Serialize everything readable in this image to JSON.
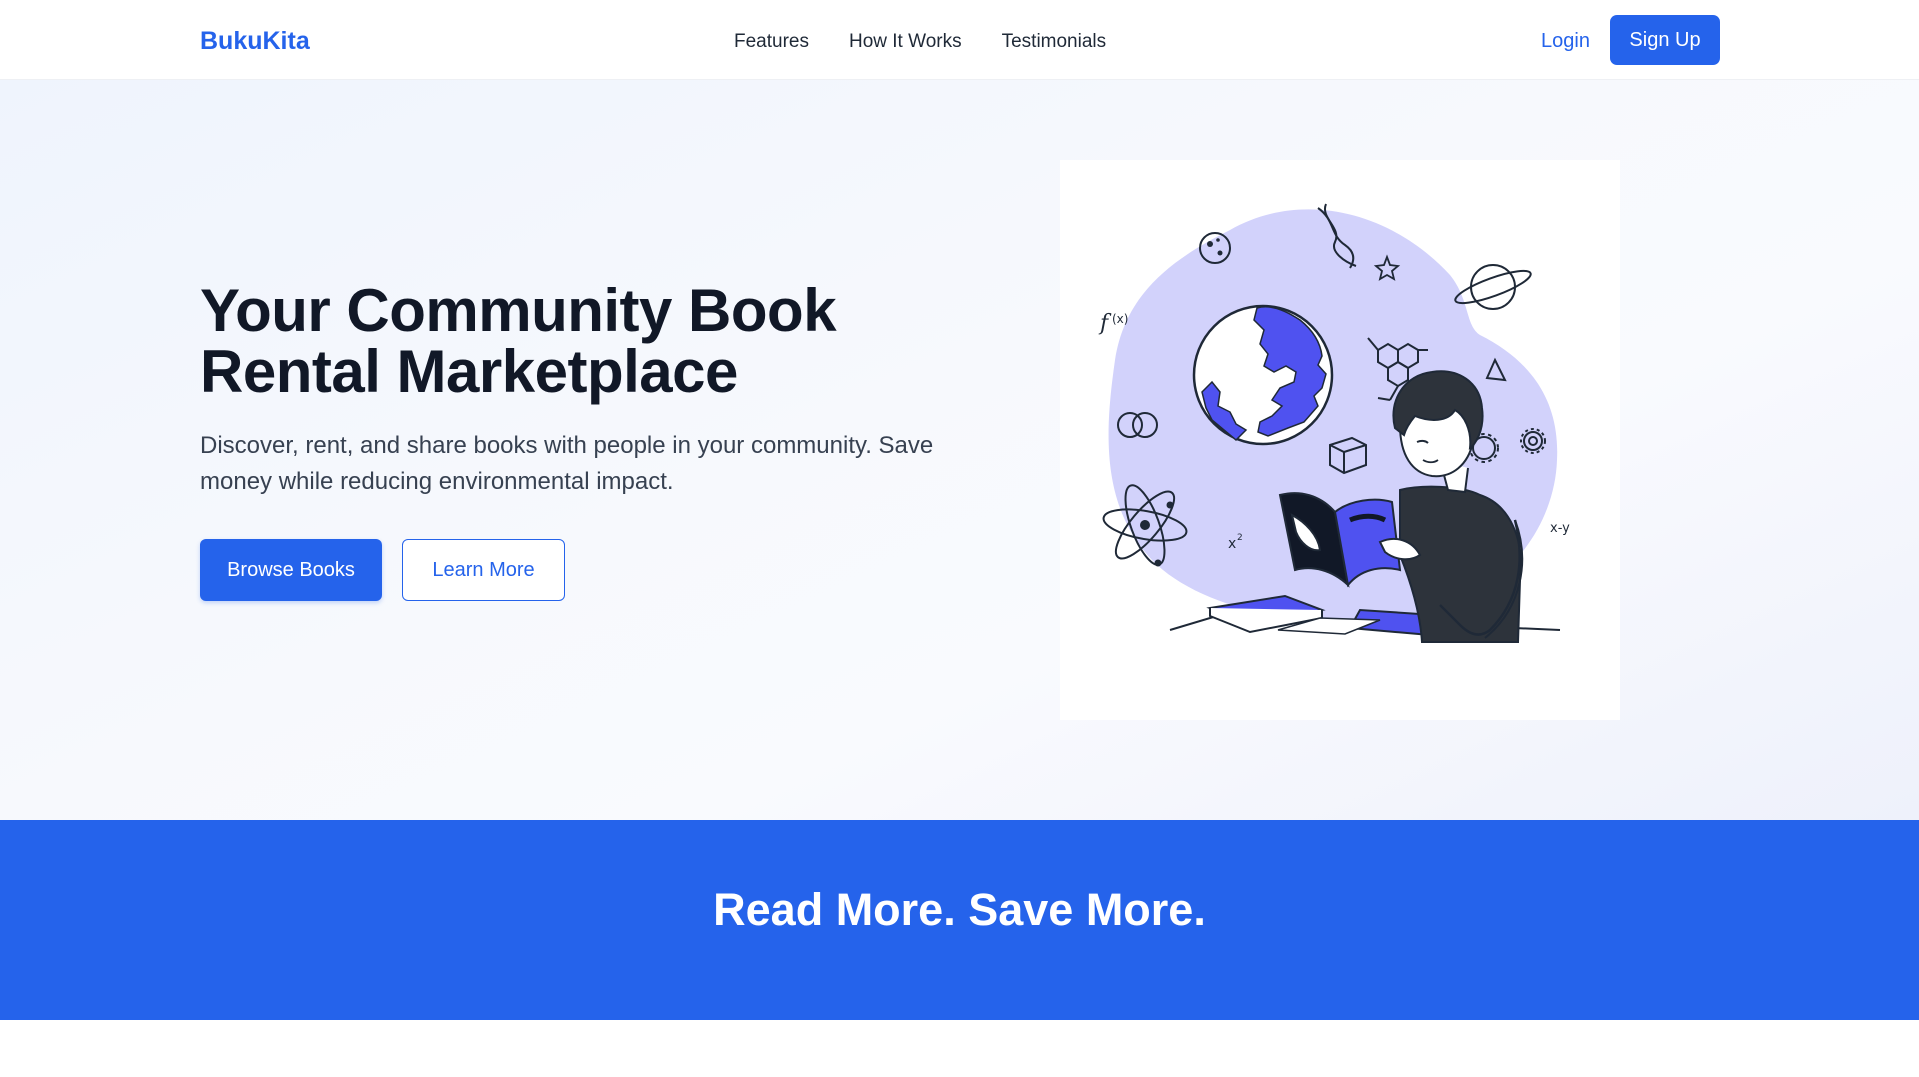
{
  "header": {
    "brand": "BukuKita",
    "nav": [
      "Features",
      "How It Works",
      "Testimonials"
    ],
    "login_label": "Login",
    "signup_label": "Sign Up"
  },
  "hero": {
    "title": "Your Community Book Rental Marketplace",
    "description": "Discover, rent, and share books with people in your community. Save money while reducing environmental impact.",
    "browse_label": "Browse Books",
    "learn_label": "Learn More",
    "illustration": "person-reading-book-illustration"
  },
  "banner": {
    "title": "Read More. Save More."
  },
  "colors": {
    "primary": "#2563eb",
    "accent_purple": "#4f52f0",
    "blob_lavender": "#d2d2fb",
    "text_dark": "#111827"
  }
}
